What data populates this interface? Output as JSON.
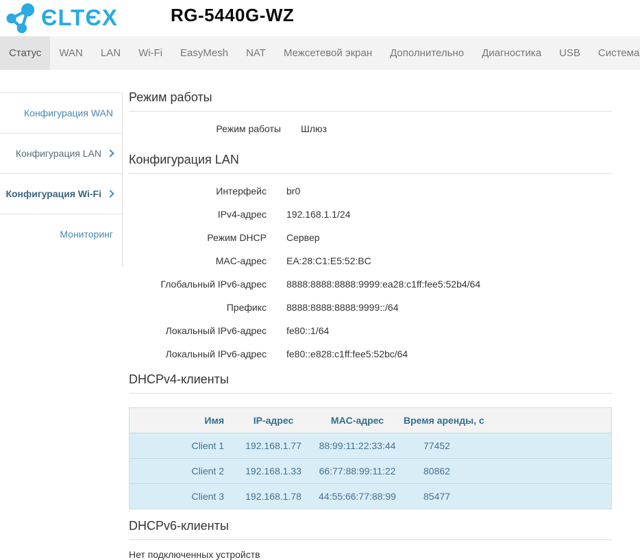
{
  "colors": {
    "brand_blue": "#2baadf",
    "tabbar_bg": "#f3f3f3",
    "active_tab_bg": "#e3e3e3",
    "sidebar_link": "#4688b2",
    "sidebar_active": "#3a6580",
    "table_header_text": "#31708f",
    "table_row_bg": "#d9edf7",
    "table_row_text": "#44738f"
  },
  "header": {
    "logo_text": "ЄLTЄX",
    "title": "RG-5440G-WZ"
  },
  "tabs": [
    {
      "label": "Статус",
      "active": true
    },
    {
      "label": "WAN",
      "active": false
    },
    {
      "label": "LAN",
      "active": false
    },
    {
      "label": "Wi-Fi",
      "active": false
    },
    {
      "label": "EasyMesh",
      "active": false
    },
    {
      "label": "NAT",
      "active": false
    },
    {
      "label": "Межсетевой экран",
      "active": false
    },
    {
      "label": "Дополнительно",
      "active": false
    },
    {
      "label": "Диагностика",
      "active": false
    },
    {
      "label": "USB",
      "active": false
    },
    {
      "label": "Система",
      "active": false
    }
  ],
  "sidebar": {
    "items": [
      {
        "label": "Конфигурация WAN",
        "chevron": false,
        "state": "link"
      },
      {
        "label": "Конфигурация LAN",
        "chevron": true,
        "state": "muted"
      },
      {
        "label": "Конфигурация Wi-Fi",
        "chevron": true,
        "state": "active"
      },
      {
        "label": "Мониторинг",
        "chevron": false,
        "state": "link"
      }
    ]
  },
  "sections": {
    "mode": {
      "title": "Режим работы",
      "rows": [
        {
          "label": "Режим работы",
          "value": "Шлюз"
        }
      ]
    },
    "lan": {
      "title": "Конфигурация LAN",
      "rows": [
        {
          "label": "Интерфейс",
          "value": "br0"
        },
        {
          "label": "IPv4-адрес",
          "value": "192.168.1.1/24"
        },
        {
          "label": "Режим DHCP",
          "value": "Сервер"
        },
        {
          "label": "MAC-адрес",
          "value": "EA:28:C1:E5:52:BC"
        },
        {
          "label": "Глобальный IPv6-адрес",
          "value": "8888:8888:8888:9999:ea28:c1ff:fee5:52b4/64"
        },
        {
          "label": "Префикс",
          "value": "8888:8888:8888:9999::/64"
        },
        {
          "label": "Локальный IPv6-адрес",
          "value": "fe80::1/64"
        },
        {
          "label": "Локальный IPv6-адрес",
          "value": "fe80::e828:c1ff:fee5:52bc/64"
        }
      ]
    },
    "dhcpv4": {
      "title": "DHCPv4-клиенты",
      "table": {
        "headers": [
          "Имя",
          "IP-адрес",
          "MAC-адрес",
          "Время аренды, с"
        ],
        "rows": [
          [
            "Client 1",
            "192.168.1.77",
            "88:99:11:22:33:44",
            "77452"
          ],
          [
            "Client 2",
            "192.168.1.33",
            "66:77:88:99:11:22",
            "80862"
          ],
          [
            "Client 3",
            "192.168.1.78",
            "44:55:66:77:88:99",
            "85477"
          ]
        ]
      }
    },
    "dhcpv6": {
      "title": "DHCPv6-клиенты",
      "empty_text": "Нет подключенных устройств"
    }
  }
}
